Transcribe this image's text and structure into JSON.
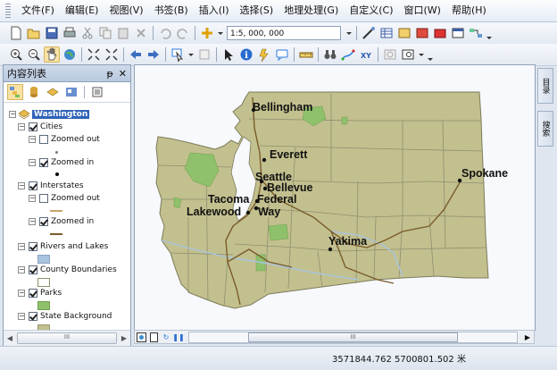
{
  "menu": [
    "文件(F)",
    "编辑(E)",
    "视图(V)",
    "书签(B)",
    "插入(I)",
    "选择(S)",
    "地理处理(G)",
    "自定义(C)",
    "窗口(W)",
    "帮助(H)"
  ],
  "toolbar1": {
    "scale_value": "1:5, 000, 000",
    "icons": [
      "new-icon",
      "open-icon",
      "save-icon",
      "print-icon",
      "cut-icon",
      "copy-icon",
      "paste-icon",
      "delete-icon",
      "undo-icon",
      "redo-icon",
      "add-data-icon",
      "scale-dropdown-icon",
      "editor-icon",
      "table-icon",
      "catalog-icon",
      "arctoolbox-icon",
      "python-icon",
      "model-builder-icon"
    ]
  },
  "toolbar2": {
    "icons": [
      "zoom-in-icon",
      "zoom-out-icon",
      "pan-icon",
      "full-extent-icon",
      "fixed-zoom-in-icon",
      "fixed-zoom-out-icon",
      "back-icon",
      "forward-icon",
      "select-features-icon",
      "clear-selection-icon",
      "select-elements-icon",
      "identify-icon",
      "hyperlink-icon",
      "html-popup-icon",
      "measure-icon",
      "find-icon",
      "find-route-icon",
      "goto-xy-icon",
      "time-slider-icon",
      "create-viewer-icon"
    ]
  },
  "toc": {
    "title": "内容列表",
    "pin": "ᵽ",
    "close": "✕",
    "frame_name": "Washington",
    "layers": [
      {
        "name": "Cities",
        "checked": true,
        "expanded": true,
        "classes": [
          {
            "label": "Zoomed out",
            "checked": false
          },
          {
            "label": "Zoomed in",
            "checked": true
          }
        ]
      },
      {
        "name": "Interstates",
        "checked": true,
        "expanded": true,
        "classes": [
          {
            "label": "Zoomed out",
            "checked": false
          },
          {
            "label": "Zoomed in",
            "checked": true
          }
        ]
      },
      {
        "name": "Rivers and Lakes",
        "checked": true,
        "expanded": true
      },
      {
        "name": "County Boundaries",
        "checked": true,
        "expanded": true
      },
      {
        "name": "Parks",
        "checked": true,
        "expanded": true
      },
      {
        "name": "State Background",
        "checked": true,
        "expanded": true
      }
    ]
  },
  "map": {
    "cities": [
      "Bellingham",
      "Everett",
      "Seattle",
      "Bellevue",
      "Tacoma",
      "Federal",
      "Way",
      "Lakewood",
      "Yakima",
      "Spokane"
    ]
  },
  "side_tabs": [
    "目录",
    "搜索"
  ],
  "status": {
    "coordinates": "3571844.762  5700801.502 米"
  },
  "colors": {
    "state_fill": "#c3c08f",
    "county_line": "#8d8f6f",
    "park": "#8fc06b",
    "water": "#a9c4df",
    "interstate": "#7a5b2a"
  }
}
